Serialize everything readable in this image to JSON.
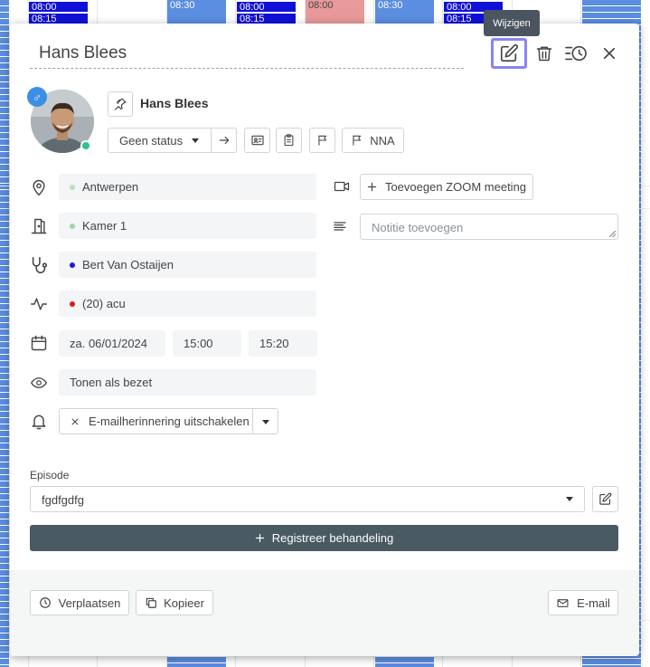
{
  "background": {
    "slot_time_1": "08:00",
    "slot_time_2": "08:15",
    "slot_time_3": "08:30"
  },
  "header": {
    "title": "Hans Blees",
    "tooltip": "Wijzigen",
    "icons": [
      "edit-icon",
      "trash-icon",
      "history-icon",
      "close-icon"
    ]
  },
  "patient": {
    "name": "Hans Blees",
    "gender_symbol": "♂",
    "status": "Geen status",
    "nna_label": "NNA"
  },
  "fields": {
    "location": "Antwerpen",
    "room": "Kamer 1",
    "practitioner": "Bert Van Ostaijen",
    "treatment": "(20) acu",
    "date": "za. 06/01/2024",
    "start_time": "15:00",
    "end_time": "15:20",
    "visibility": "Tonen als bezet",
    "reminder": "E-mailherinnering uitschakelen"
  },
  "colors": {
    "location_dot": "#b9dfc2",
    "room_dot": "#9ed6a8",
    "practitioner_dot": "#1a1ae0",
    "treatment_dot": "#e01a1a",
    "accent_dark": "#4a5a63",
    "highlight": "#8b83f5"
  },
  "zoom": {
    "add_label": "Toevoegen ZOOM meeting"
  },
  "notes": {
    "placeholder": "Notitie toevoegen"
  },
  "episode": {
    "label": "Episode",
    "value": "fgdfgdfg"
  },
  "actions": {
    "register_label": "Registreer behandeling",
    "move_label": "Verplaatsen",
    "copy_label": "Kopieer",
    "email_label": "E-mail"
  }
}
